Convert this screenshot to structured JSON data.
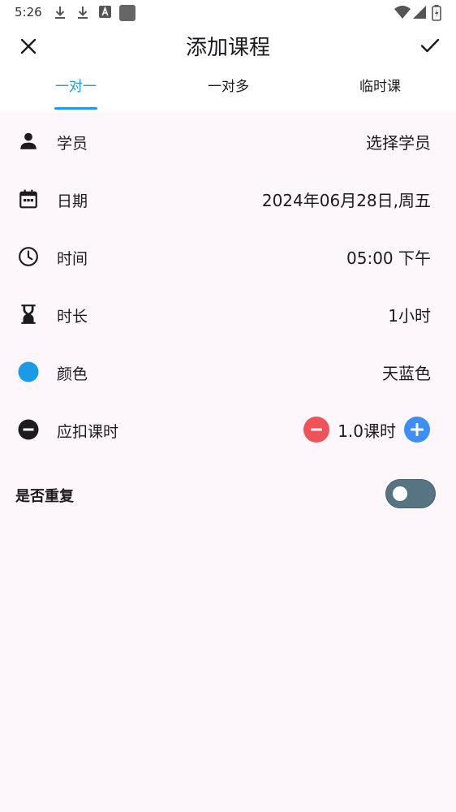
{
  "status_bar": {
    "time": "5:26",
    "left_icons": [
      "download-icon",
      "download-icon",
      "keyboard-a-icon",
      "app-square-icon"
    ],
    "right_icons": [
      "wifi-icon",
      "signal-icon",
      "battery-icon"
    ]
  },
  "app_bar": {
    "title": "添加课程",
    "close_icon": "close-icon",
    "confirm_icon": "check-icon"
  },
  "tabs": [
    {
      "label": "一对一",
      "active": true
    },
    {
      "label": "一对多",
      "active": false
    },
    {
      "label": "临时课",
      "active": false
    }
  ],
  "rows": {
    "student": {
      "icon": "person-icon",
      "label": "学员",
      "value": "选择学员"
    },
    "date": {
      "icon": "calendar-icon",
      "label": "日期",
      "value": "2024年06月28日,周五"
    },
    "time": {
      "icon": "clock-icon",
      "label": "时间",
      "value": "05:00 下午"
    },
    "duration": {
      "icon": "hourglass-icon",
      "label": "时长",
      "value": "1小时"
    },
    "color": {
      "icon": "color-dot-icon",
      "label": "颜色",
      "value": "天蓝色",
      "swatch": "#1a9be8"
    },
    "deduct": {
      "icon": "minus-circle-icon",
      "label": "应扣课时",
      "value": "1.0课时"
    }
  },
  "repeat": {
    "label": "是否重复",
    "enabled": false
  },
  "colors": {
    "accent": "#2196f3",
    "minus_button": "#f0525a",
    "plus_button": "#3f8ef5",
    "toggle_track": "#567482",
    "background": "#fdf7fb"
  }
}
